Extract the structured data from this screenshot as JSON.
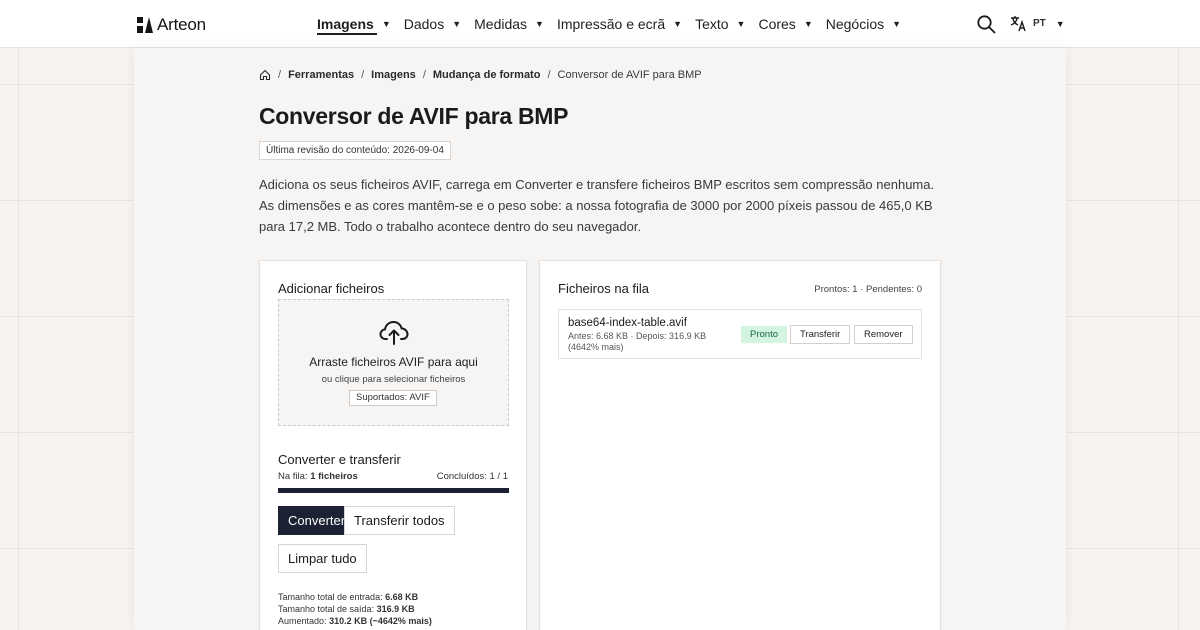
{
  "header": {
    "logo_text": "Arteon",
    "nav": [
      {
        "label": "Imagens",
        "active": true
      },
      {
        "label": "Dados"
      },
      {
        "label": "Medidas"
      },
      {
        "label": "Impressão e ecrã"
      },
      {
        "label": "Texto"
      },
      {
        "label": "Cores"
      },
      {
        "label": "Negócios"
      }
    ],
    "language": "PT",
    "caret": "▼"
  },
  "breadcrumb": {
    "sep": "/",
    "items": [
      "Ferramentas",
      "Imagens",
      "Mudança de formato"
    ],
    "current": "Conversor de AVIF para BMP"
  },
  "page": {
    "title": "Conversor de AVIF para BMP",
    "revision": "Última revisão do conteúdo: 2026-09-04",
    "intro": "Adiciona os seus ficheiros AVIF, carrega em Converter e transfere ficheiros BMP escritos sem compressão nenhuma. As dimensões e as cores mantêm-se e o peso sobe: a nossa fotografia de 3000 por 2000 píxeis passou de 465,0 KB para 17,2 MB. Todo o trabalho acontece dentro do seu navegador."
  },
  "upload": {
    "title": "Adicionar ficheiros",
    "drop_title": "Arraste ficheiros AVIF para aqui",
    "drop_sub": "ou clique para selecionar ficheiros",
    "supported": "Suportados: AVIF"
  },
  "convert": {
    "title": "Converter e transferir",
    "queue_label": "Na fila:",
    "queue_value": "1 ficheiros",
    "done": "Concluídos: 1 / 1",
    "progress": 1.0,
    "convert_label": "Converter",
    "transfer_all_label": "Transferir todos",
    "clear_label": "Limpar tudo",
    "totals": {
      "input_label": "Tamanho total de entrada:",
      "input_value": "6.68 KB",
      "output_label": "Tamanho total de saída:",
      "output_value": "316.9 KB",
      "increase_label": "Aumentado:",
      "increase_value": "310.2 KB (~4642% mais)"
    }
  },
  "queue": {
    "title": "Ficheiros na fila",
    "stats": "Prontos: 1 · Pendentes: 0",
    "files": [
      {
        "name": "base64-index-table.avif",
        "meta": "Antes: 6.68 KB · Depois: 316.9 KB (4642% mais)",
        "status": "Pronto",
        "transfer_label": "Transferir",
        "remove_label": "Remover"
      }
    ]
  },
  "colors": {
    "primary": "#1c2233",
    "ready_bg": "#d4f4e2",
    "ready_text": "#17683c"
  }
}
